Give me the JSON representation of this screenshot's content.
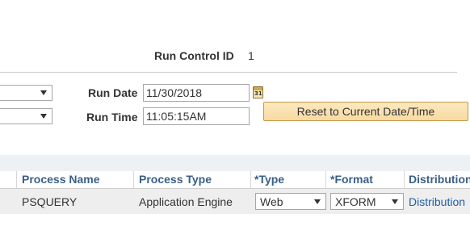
{
  "header": {
    "run_control_label": "Run Control ID",
    "run_control_value": "1"
  },
  "fields": {
    "run_date_label": "Run Date",
    "run_date_value": "11/30/2018",
    "run_time_label": "Run Time",
    "run_time_value": "11:05:15AM",
    "reset_button": "Reset to Current Date/Time",
    "dropdown1_value": "",
    "dropdown2_value": ""
  },
  "grid": {
    "columns": [
      "Process Name",
      "Process Type",
      "*Type",
      "*Format",
      "Distribution"
    ],
    "rows": [
      {
        "process_name": "PSQUERY",
        "process_type": "Application Engine",
        "type": "Web",
        "format": "XFORM",
        "distribution": "Distribution"
      }
    ]
  },
  "icons": {
    "calendar": "calendar-icon",
    "calendar_text": "31"
  }
}
